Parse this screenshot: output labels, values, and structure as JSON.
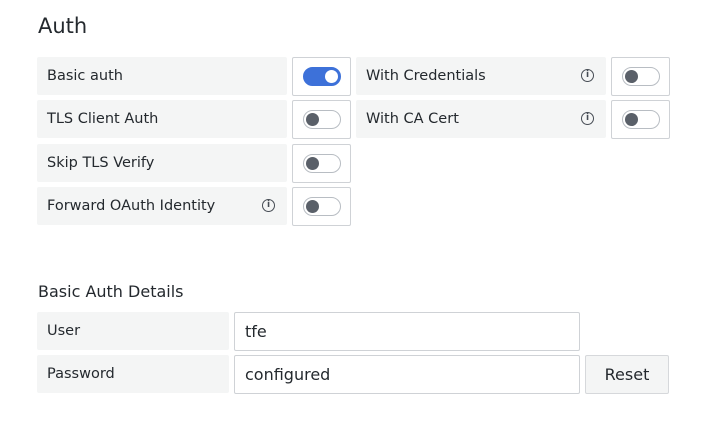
{
  "auth": {
    "title": "Auth",
    "toggles": {
      "basic_auth": {
        "label": "Basic auth",
        "on": true
      },
      "tls_client_auth": {
        "label": "TLS Client Auth",
        "on": false
      },
      "skip_tls_verify": {
        "label": "Skip TLS Verify",
        "on": false
      },
      "forward_oauth": {
        "label": "Forward OAuth Identity",
        "on": false
      },
      "with_credentials": {
        "label": "With Credentials",
        "on": false
      },
      "with_ca_cert": {
        "label": "With CA Cert",
        "on": false
      }
    },
    "info_glyph": "i"
  },
  "basic_auth_details": {
    "title": "Basic Auth Details",
    "user_label": "User",
    "user_value": "tfe",
    "password_label": "Password",
    "password_value": "configured",
    "reset_label": "Reset"
  },
  "colors": {
    "accent": "#3d71d9",
    "label_bg": "#f4f5f5"
  }
}
